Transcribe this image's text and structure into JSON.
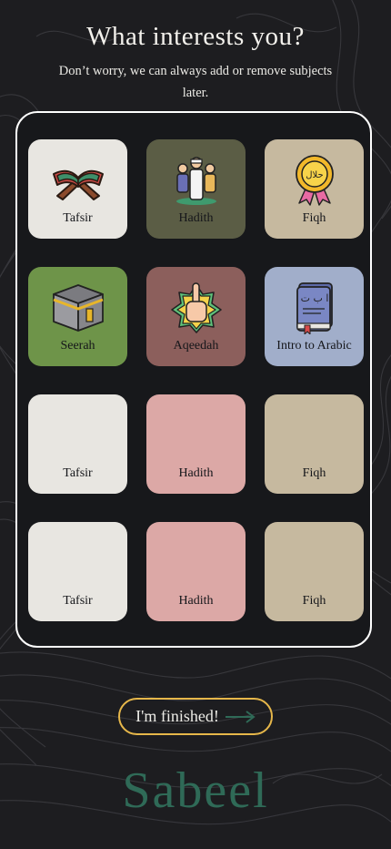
{
  "header": {
    "title": "What interests you?",
    "subtitle": "Don’t worry, we can always add or remove subjects later."
  },
  "tiles": [
    {
      "label": "Tafsir",
      "color": "#e8e6e1",
      "icon": "quran-stand-icon"
    },
    {
      "label": "Hadith",
      "color": "#5b5d45",
      "icon": "people-praying-icon"
    },
    {
      "label": "Fiqh",
      "color": "#c6b99f",
      "icon": "halal-badge-icon"
    },
    {
      "label": "Seerah",
      "color": "#6e9449",
      "icon": "kaaba-icon"
    },
    {
      "label": "Aqeedah",
      "color": "#8c5f5c",
      "icon": "raised-finger-star-icon"
    },
    {
      "label": "Intro to Arabic",
      "color": "#a1aeca",
      "icon": "arabic-book-icon"
    },
    {
      "label": "Tafsir",
      "color": "#e8e6e1",
      "icon": ""
    },
    {
      "label": "Hadith",
      "color": "#dca8a6",
      "icon": ""
    },
    {
      "label": "Fiqh",
      "color": "#c6b99f",
      "icon": ""
    },
    {
      "label": "Tafsir",
      "color": "#e8e6e1",
      "icon": ""
    },
    {
      "label": "Hadith",
      "color": "#dca8a6",
      "icon": ""
    },
    {
      "label": "Fiqh",
      "color": "#c6b99f",
      "icon": ""
    }
  ],
  "finish_button": {
    "label": "I'm finished!",
    "icon": "arrow-right-icon",
    "border_color": "#e6b74a"
  },
  "brand": {
    "name": "Sabeel",
    "color": "#2f6a57"
  }
}
